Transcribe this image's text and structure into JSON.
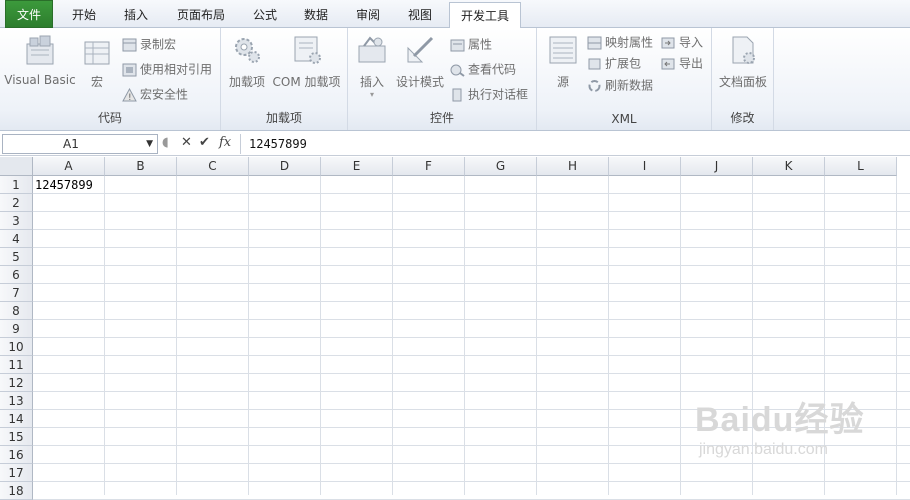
{
  "tabs": [
    "文件",
    "开始",
    "插入",
    "页面布局",
    "公式",
    "数据",
    "审阅",
    "视图",
    "开发工具"
  ],
  "ribbon": {
    "code": {
      "label": "代码",
      "visual_basic": "Visual Basic",
      "macros": "宏",
      "record_macro": "录制宏",
      "relative_refs": "使用相对引用",
      "macro_security": "宏安全性"
    },
    "addins": {
      "label": "加载项",
      "addins": "加载项",
      "com_addins": "COM 加载项"
    },
    "controls": {
      "label": "控件",
      "insert": "插入",
      "design_mode": "设计模式",
      "properties": "属性",
      "view_code": "查看代码",
      "run_dialog": "执行对话框"
    },
    "xml": {
      "label": "XML",
      "source": "源",
      "map_properties": "映射属性",
      "expansion_packs": "扩展包",
      "refresh_data": "刷新数据",
      "import": "导入",
      "export": "导出"
    },
    "modify": {
      "label": "修改",
      "document_panel": "文档面板"
    }
  },
  "formula_bar": {
    "name_box": "A1",
    "fx": "fx",
    "content": "12457899"
  },
  "sheet": {
    "columns": [
      "A",
      "B",
      "C",
      "D",
      "E",
      "F",
      "G",
      "H",
      "I",
      "J",
      "K",
      "L"
    ],
    "rows": [
      "1",
      "2",
      "3",
      "4",
      "5",
      "6",
      "7",
      "8",
      "9",
      "10",
      "11",
      "12",
      "13",
      "14",
      "15",
      "16",
      "17",
      "18"
    ],
    "a1_value": "12457899"
  },
  "watermark": {
    "brand": "Baidu经验",
    "url": "jingyan.baidu.com"
  },
  "colors": {
    "file_tab": "#2d7d2d",
    "ribbon_bg": "#eef2f8",
    "grid_line": "#dadfe6"
  }
}
